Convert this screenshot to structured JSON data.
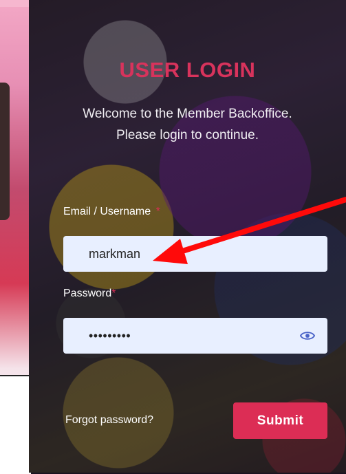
{
  "login": {
    "title": "USER LOGIN",
    "subtitle_line1": "Welcome to the Member Backoffice.",
    "subtitle_line2": "Please login to continue.",
    "email_label": "Email / Username",
    "email_required": "*",
    "email_value": "markman",
    "password_label": "Password",
    "password_required": "*",
    "password_value": "•••••••••",
    "forgot_label": "Forgot password?",
    "submit_label": "Submit"
  },
  "icons": {
    "password_toggle": "eye-icon",
    "annotation": "red-arrow"
  },
  "colors": {
    "accent": "#dc2d55",
    "title": "#d8335c",
    "field_bg": "#e8efff",
    "eye": "#4a63c8",
    "annotation": "#ff0a0a"
  }
}
